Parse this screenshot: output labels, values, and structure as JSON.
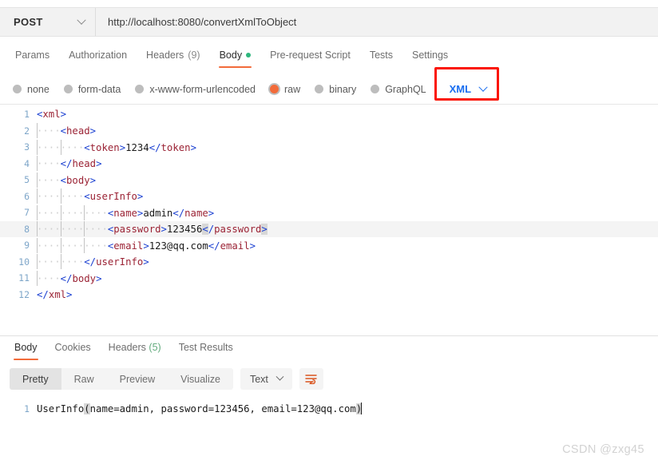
{
  "request": {
    "method": "POST",
    "method_chevron_icon": "chevron-down-icon",
    "url": "http://localhost:8080/convertXmlToObject",
    "tabs": [
      {
        "label": "Params",
        "active": false
      },
      {
        "label": "Authorization",
        "active": false
      },
      {
        "label": "Headers",
        "count": "(9)",
        "active": false
      },
      {
        "label": "Body",
        "active": true,
        "dot": "green-status-dot"
      },
      {
        "label": "Pre-request Script",
        "active": false
      },
      {
        "label": "Tests",
        "active": false
      },
      {
        "label": "Settings",
        "active": false
      }
    ],
    "body_types": [
      {
        "label": "none",
        "checked": false
      },
      {
        "label": "form-data",
        "checked": false
      },
      {
        "label": "x-www-form-urlencoded",
        "checked": false
      },
      {
        "label": "raw",
        "checked": true
      },
      {
        "label": "binary",
        "checked": false
      },
      {
        "label": "GraphQL",
        "checked": false
      }
    ],
    "format_select": {
      "value": "XML",
      "chevron_icon": "chevron-down-icon",
      "highlight_color": "#fb1405",
      "text_color": "#1a6ef0"
    }
  },
  "editor": {
    "line_numbers": [
      "1",
      "2",
      "3",
      "4",
      "5",
      "6",
      "7",
      "8",
      "9",
      "10",
      "11",
      "12"
    ],
    "lines": [
      {
        "n": "1",
        "indent": 0,
        "content": "<xml>"
      },
      {
        "n": "2",
        "indent": 1,
        "content": "<head>"
      },
      {
        "n": "3",
        "indent": 2,
        "content": "<token>1234</token>"
      },
      {
        "n": "4",
        "indent": 1,
        "content": "</head>"
      },
      {
        "n": "5",
        "indent": 1,
        "content": "<body>"
      },
      {
        "n": "6",
        "indent": 2,
        "content": "<userInfo>"
      },
      {
        "n": "7",
        "indent": 3,
        "content": "<name>admin</name>"
      },
      {
        "n": "8",
        "indent": 3,
        "content": "<password>123456</password>"
      },
      {
        "n": "9",
        "indent": 3,
        "content": "<email>123@qq.com</email>"
      },
      {
        "n": "10",
        "indent": 2,
        "content": "</userInfo>"
      },
      {
        "n": "11",
        "indent": 1,
        "content": "</body>"
      },
      {
        "n": "12",
        "indent": 0,
        "content": "</xml>"
      }
    ],
    "raw_text": "<xml>\n    <head>\n        <token>1234</token>\n    </head>\n    <body>\n        <userInfo>\n            <name>admin</name>\n            <password>123456</password>\n            <email>123@qq.com</email>\n        </userInfo>\n    </body>\n</xml>",
    "colors": {
      "bracket": "#1a3fd1",
      "tag_name": "#9b2335",
      "text": "#1b1b1b",
      "line_number": "#7ea6c9",
      "bracket_match_bg": "#d7d7d7"
    }
  },
  "response": {
    "tabs": [
      {
        "label": "Body",
        "active": true
      },
      {
        "label": "Cookies",
        "active": false
      },
      {
        "label": "Headers",
        "count": "(5)",
        "active": false
      },
      {
        "label": "Test Results",
        "active": false
      }
    ],
    "view_modes": [
      {
        "label": "Pretty",
        "active": true
      },
      {
        "label": "Raw",
        "active": false
      },
      {
        "label": "Preview",
        "active": false
      },
      {
        "label": "Visualize",
        "active": false
      }
    ],
    "format_select": {
      "value": "Text",
      "chevron_icon": "chevron-down-icon"
    },
    "wrap_button_icon": "word-wrap-icon",
    "line_number": "1",
    "body_text": "UserInfo(name=admin, password=123456, email=123@qq.com)",
    "body_parts": {
      "prefix": "UserInfo",
      "open_paren": "(",
      "fields": "name=admin, password=123456, email=123@qq.com",
      "close_paren": ")"
    }
  },
  "watermark": {
    "text": "CSDN @zxg45"
  }
}
